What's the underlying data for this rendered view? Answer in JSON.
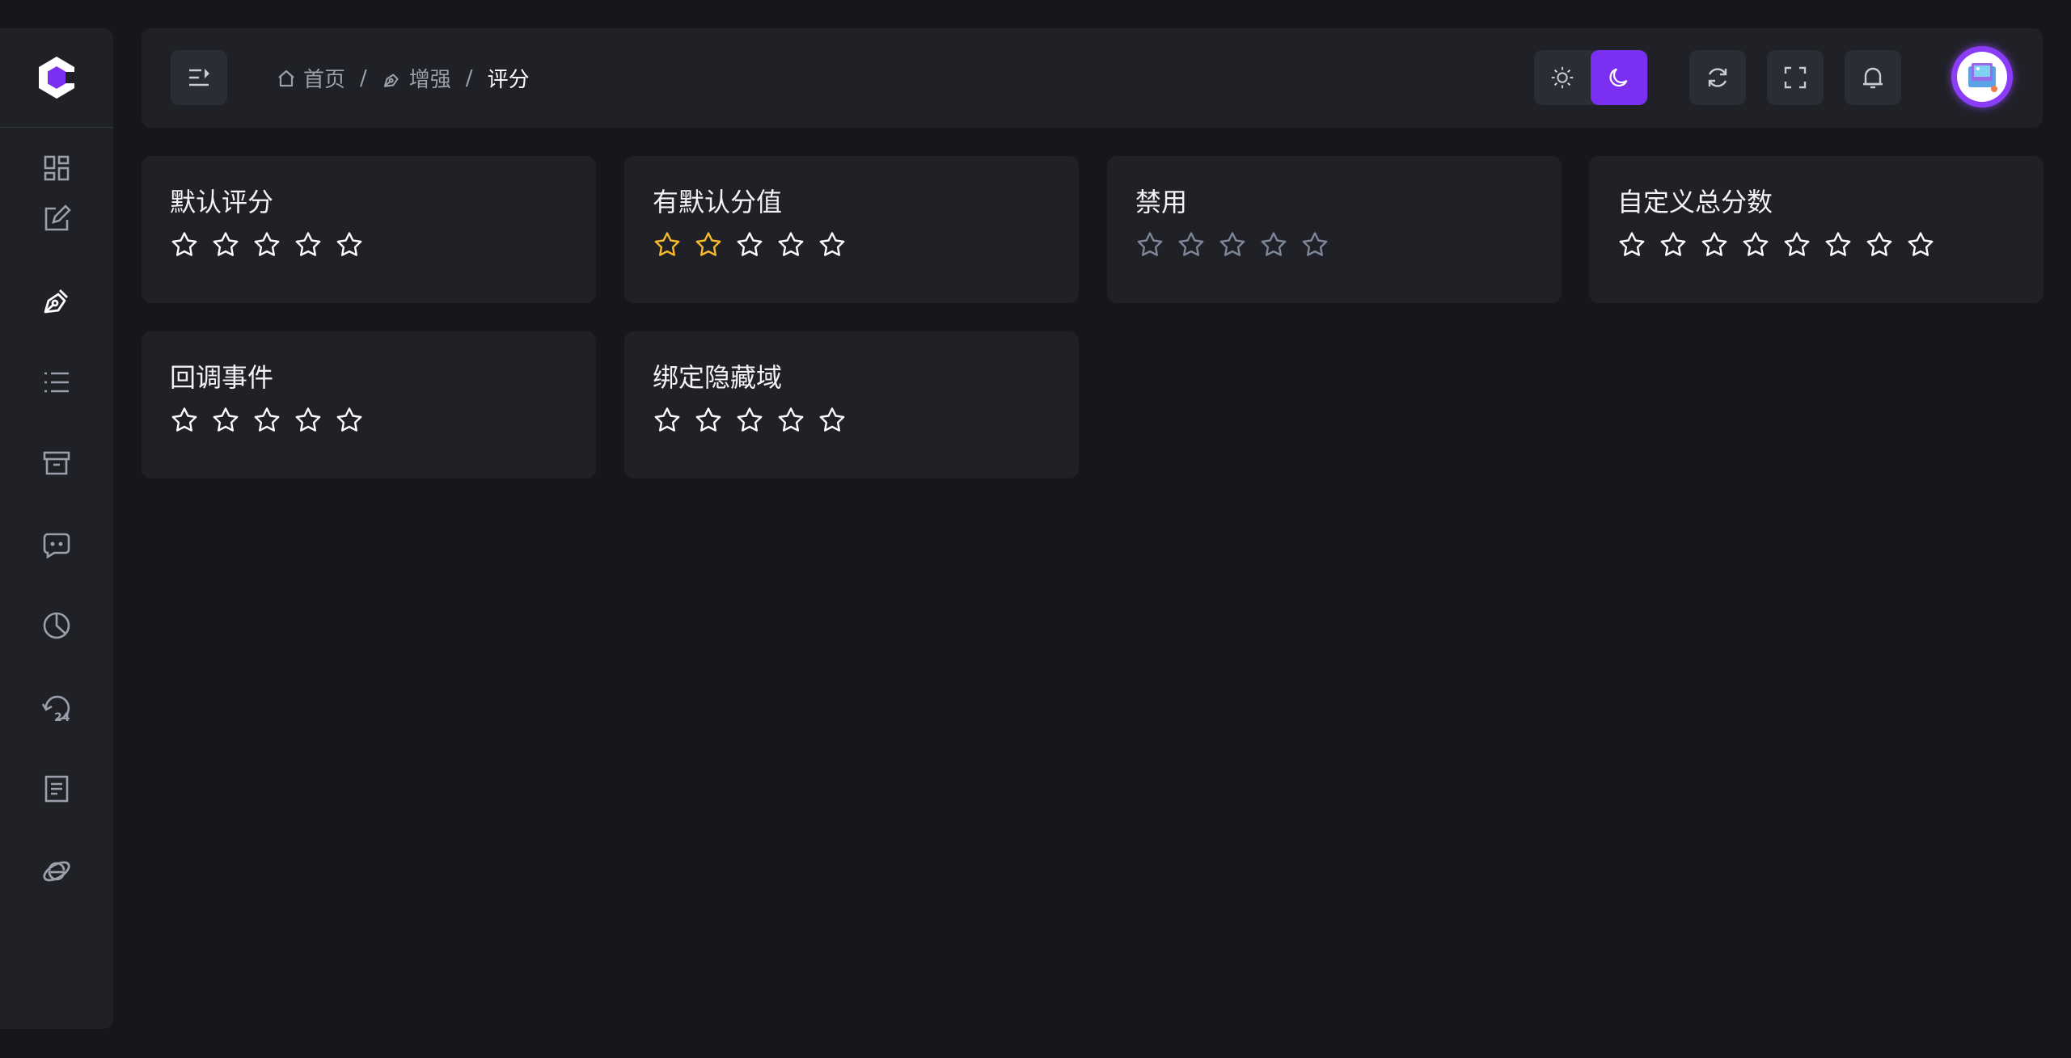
{
  "colors": {
    "accent": "#7b2ff0",
    "star_active": "#f7ba2a",
    "star_inactive": "#ffffff",
    "star_disabled": "#7e879a",
    "panel_bg": "#202127",
    "page_bg": "#16171b"
  },
  "sidebar": {
    "logo_icon": "cube-logo-icon",
    "items": [
      {
        "icon": "dashboard-icon"
      },
      {
        "icon": "edit-icon"
      },
      {
        "icon": "pen-nib-icon",
        "active": true
      },
      {
        "icon": "list-icon"
      },
      {
        "icon": "archive-icon"
      },
      {
        "icon": "chat-icon"
      },
      {
        "icon": "pie-chart-icon"
      },
      {
        "icon": "history-24-icon"
      },
      {
        "icon": "document-icon"
      },
      {
        "icon": "ie-browser-icon"
      }
    ]
  },
  "header": {
    "breadcrumb": [
      {
        "label": "首页",
        "icon": "home-icon"
      },
      {
        "label": "增强",
        "icon": "pen-nib-icon"
      },
      {
        "label": "评分"
      }
    ],
    "separator": "/",
    "theme": {
      "light_icon": "sun-icon",
      "dark_icon": "moon-icon",
      "selected": "dark"
    },
    "actions": [
      "refresh-icon",
      "fullscreen-icon",
      "bell-icon"
    ]
  },
  "cards": [
    {
      "title": "默认评分",
      "max": 5,
      "value": 0,
      "disabled": false
    },
    {
      "title": "有默认分值",
      "max": 5,
      "value": 2,
      "disabled": false
    },
    {
      "title": "禁用",
      "max": 5,
      "value": 0,
      "disabled": true
    },
    {
      "title": "自定义总分数",
      "max": 8,
      "value": 0,
      "disabled": false
    },
    {
      "title": "回调事件",
      "max": 5,
      "value": 0,
      "disabled": false
    },
    {
      "title": "绑定隐藏域",
      "max": 5,
      "value": 0,
      "disabled": false
    }
  ]
}
